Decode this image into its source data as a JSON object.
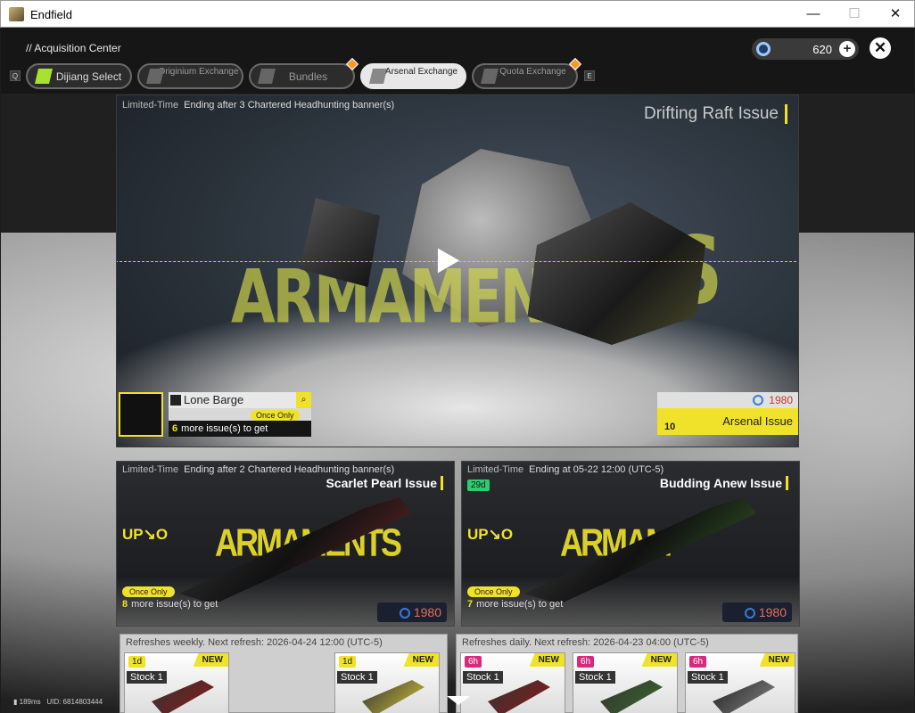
{
  "window": {
    "title": "Endfield",
    "minimize": "—",
    "maximize": "☐",
    "close": "✕"
  },
  "header": {
    "breadcrumb": "// Acquisition Center",
    "currency_value": "620",
    "left_key": "Q",
    "right_key": "E"
  },
  "tabs": [
    {
      "label": "Dijiang Select",
      "selected": false
    },
    {
      "label": "Originium Exchange",
      "selected": false
    },
    {
      "label": "Bundles",
      "selected": false,
      "alert": true
    },
    {
      "label": "Arsenal Exchange",
      "selected": true
    },
    {
      "label": "Quota Exchange",
      "selected": false,
      "alert": true
    }
  ],
  "hero": {
    "limited": "Limited-Time",
    "ending": "Ending after 3 Chartered Headhunting banner(s)",
    "issue_name": "Drifting Raft Issue",
    "big_text": "ARMAMENTS",
    "big_text_right": "TS",
    "prize_name": "Lone Barge",
    "once_only": "Once Only",
    "more_count": "6",
    "more_text": "more issue(s) to get",
    "price": "1980",
    "arsenal_label": "Arsenal Issue",
    "arsenal_logo": "10"
  },
  "cards": [
    {
      "limited": "Limited-Time",
      "ending": "Ending after 2 Chartered Headhunting banner(s)",
      "name": "Scarlet Pearl Issue",
      "upno": "UP↘O",
      "big_text": "ARMAMENTS",
      "once": "Once Only",
      "more_count": "8",
      "more_text": "more issue(s) to get",
      "price": "1980",
      "days": ""
    },
    {
      "limited": "Limited-Time",
      "ending": "Ending at 05-22 12:00 (UTC-5)",
      "name": "Budding Anew Issue",
      "upno": "UP↘O",
      "big_text": "ARMAM",
      "once": "Once Only",
      "more_count": "7",
      "more_text": "more issue(s) to get",
      "price": "1980",
      "days": "29d"
    }
  ],
  "shops": [
    {
      "refresh": "Refreshes weekly. Next refresh: 2026-04-24 12:00 (UTC-5)",
      "items": [
        {
          "time": "1d",
          "stock": "Stock 1",
          "new": "NEW"
        },
        {
          "time": "1d",
          "stock": "Stock 1",
          "new": "NEW"
        }
      ]
    },
    {
      "refresh": "Refreshes daily. Next refresh: 2026-04-23 04:00 (UTC-5)",
      "items": [
        {
          "time": "6h",
          "stock": "Stock 1",
          "new": "NEW"
        },
        {
          "time": "6h",
          "stock": "Stock 1",
          "new": "NEW"
        },
        {
          "time": "6h",
          "stock": "Stock 1",
          "new": "NEW"
        }
      ]
    }
  ],
  "footer": {
    "ping": "189ms",
    "uid": "UID: 6814803444"
  }
}
